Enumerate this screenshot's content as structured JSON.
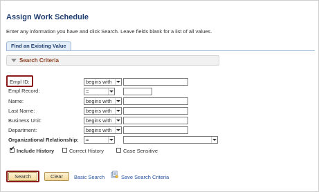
{
  "page": {
    "title": "Assign Work Schedule",
    "instructions": "Enter any information you have and click Search. Leave fields blank for a list of all values."
  },
  "tabs": [
    {
      "label": "Find an Existing Value"
    }
  ],
  "search_criteria": {
    "title": "Search Criteria",
    "fields": [
      {
        "label": "Empl ID:",
        "operator": "begins with",
        "value": ""
      },
      {
        "label": "Empl Record:",
        "operator": "=",
        "value": ""
      },
      {
        "label": "Name:",
        "operator": "begins with",
        "value": ""
      },
      {
        "label": "Last Name:",
        "operator": "begins with",
        "value": ""
      },
      {
        "label": "Business Unit:",
        "operator": "begins with",
        "value": ""
      },
      {
        "label": "Department:",
        "operator": "begins with",
        "value": ""
      }
    ],
    "org_relationship": {
      "label": "Organizational Relationship:",
      "operator": "=",
      "value": ""
    },
    "options": [
      {
        "label": "Include History",
        "checked": true
      },
      {
        "label": "Correct History",
        "checked": false
      },
      {
        "label": "Case Sensitive",
        "checked": false
      }
    ]
  },
  "actions": {
    "search": "Search",
    "clear": "Clear",
    "basic_search": "Basic Search",
    "save_search": "Save Search Criteria"
  },
  "colors": {
    "highlight": "#8b1a1a",
    "title": "#1f3d6e",
    "section_label": "#8a3d1e",
    "link": "#1f4f9e"
  },
  "icons": {
    "save_search": "save-search-icon",
    "section_toggle": "caret-down-icon"
  }
}
